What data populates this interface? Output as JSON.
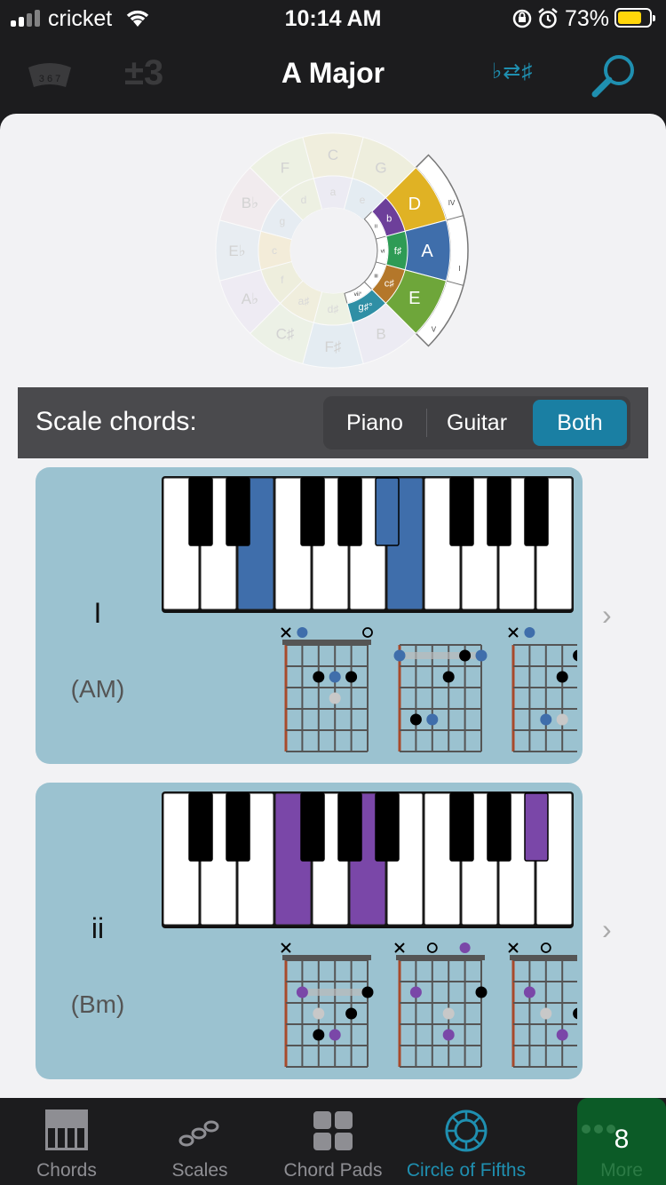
{
  "status": {
    "carrier": "cricket",
    "time": "10:14 AM",
    "battery": "73%"
  },
  "nav": {
    "title": "A Major",
    "transpose": "±3",
    "tuner_label": "3 6 7",
    "enharmonic": "♭⇄♯"
  },
  "circle": {
    "major": [
      "C",
      "G",
      "D",
      "A",
      "E",
      "B",
      "F♯",
      "C♯",
      "A♭",
      "E♭",
      "B♭",
      "F"
    ],
    "minor": [
      "a",
      "e",
      "b",
      "f♯",
      "c♯",
      "g♯°",
      "d♯",
      "a♯",
      "f",
      "c",
      "g",
      "d"
    ],
    "outer_romans": [
      "IV",
      "I",
      "V"
    ],
    "inner_romans": [
      "ii",
      "vi",
      "iii",
      "vii°"
    ],
    "colors": {
      "D": "#e0b224",
      "A": "#3f6eab",
      "E": "#6ea63a",
      "b": "#6d3f9a",
      "fs": "#2e9b55",
      "cs": "#b4772a",
      "gs": "#2f8fa5"
    }
  },
  "scale_chords": {
    "label": "Scale chords:",
    "options": [
      "Piano",
      "Guitar",
      "Both"
    ],
    "selected": "Both"
  },
  "cards": [
    {
      "roman": "I",
      "name": "(AM)",
      "color": "#3f6eab",
      "keys_white": [
        2,
        6
      ],
      "keys_black": [
        4
      ]
    },
    {
      "roman": "ii",
      "name": "(Bm)",
      "color": "#7a47a8",
      "keys_white": [
        3,
        5
      ],
      "keys_black": [
        7
      ]
    }
  ],
  "tabs": [
    {
      "label": "Chords",
      "icon": "piano-icon"
    },
    {
      "label": "Scales",
      "icon": "scale-icon"
    },
    {
      "label": "Chord Pads",
      "icon": "pads-icon"
    },
    {
      "label": "Circle of Fifths",
      "icon": "circle-icon"
    }
  ],
  "more": {
    "label": "More",
    "badge": "8"
  }
}
